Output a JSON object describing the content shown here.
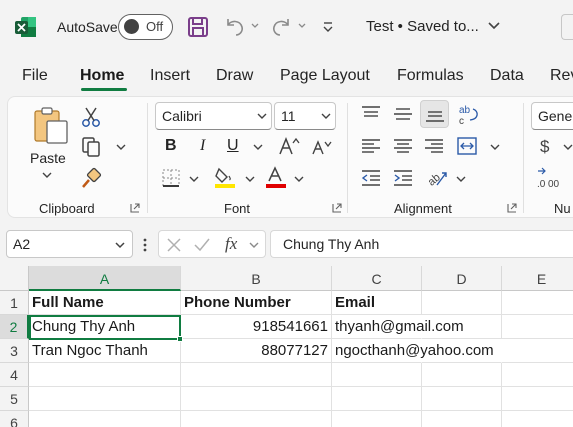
{
  "titlebar": {
    "autosave_label": "AutoSave",
    "autosave_state": "Off",
    "doc_title": "Test • Saved to..."
  },
  "tabs": [
    "File",
    "Home",
    "Insert",
    "Draw",
    "Page Layout",
    "Formulas",
    "Data",
    "Rev"
  ],
  "active_tab": "Home",
  "ribbon": {
    "clipboard": {
      "paste_label": "Paste",
      "group_label": "Clipboard"
    },
    "font": {
      "font_name": "Calibri",
      "font_size": "11",
      "group_label": "Font",
      "bold": "B",
      "italic": "I",
      "underline": "U"
    },
    "alignment": {
      "group_label": "Alignment"
    },
    "number": {
      "format": "Gener",
      "group_label": "Nu"
    }
  },
  "formula_bar": {
    "name_box": "A2",
    "fx_label": "fx",
    "content": "Chung Thy Anh"
  },
  "grid": {
    "columns": [
      "A",
      "B",
      "C",
      "D",
      "E"
    ],
    "rows": [
      "1",
      "2",
      "3",
      "4",
      "5",
      "6"
    ],
    "cells": {
      "A1": "Full Name",
      "B1": "Phone Number",
      "C1": "Email",
      "A2": "Chung Thy Anh",
      "B2": "918541661",
      "C2": "thyanh@gmail.com",
      "A3": "Tran Ngoc Thanh",
      "B3": "88077127",
      "C3": "ngocthanh@yahoo.com"
    },
    "active_cell": "A2"
  },
  "colors": {
    "accent": "#107c41",
    "highlight": "#ffe600",
    "font_color": "#e00000"
  }
}
